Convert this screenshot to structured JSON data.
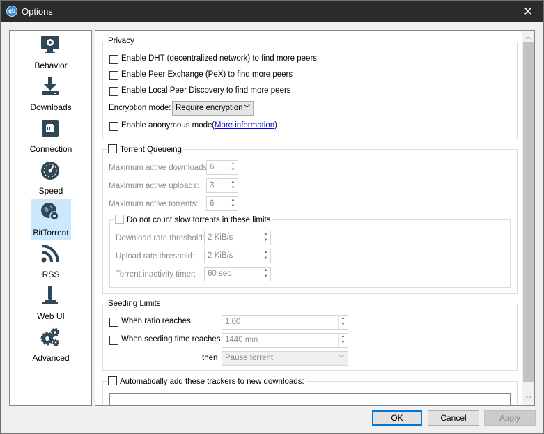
{
  "window": {
    "title": "Options",
    "app_icon_text": "qb"
  },
  "sidebar": {
    "items": [
      {
        "label": "Behavior",
        "icon": "monitor-gear-icon"
      },
      {
        "label": "Downloads",
        "icon": "download-icon"
      },
      {
        "label": "Connection",
        "icon": "network-port-icon"
      },
      {
        "label": "Speed",
        "icon": "speedometer-icon"
      },
      {
        "label": "BitTorrent",
        "icon": "globe-gear-icon",
        "selected": true
      },
      {
        "label": "RSS",
        "icon": "rss-icon"
      },
      {
        "label": "Web UI",
        "icon": "web-ui-icon"
      },
      {
        "label": "Advanced",
        "icon": "gears-icon"
      }
    ]
  },
  "privacy": {
    "title": "Privacy",
    "dht": "Enable DHT (decentralized network) to find more peers",
    "pex": "Enable Peer Exchange (PeX) to find more peers",
    "lpd": "Enable Local Peer Discovery to find more peers",
    "encryption_label": "Encryption mode:",
    "encryption_value": "Require encryption",
    "anonymous": "Enable anonymous mode",
    "paren_open": "(",
    "more_info": "More information",
    "paren_close": ")"
  },
  "queueing": {
    "title": "Torrent Queueing",
    "max_downloads_label": "Maximum active downloads:",
    "max_downloads": "6",
    "max_uploads_label": "Maximum active uploads:",
    "max_uploads": "3",
    "max_torrents_label": "Maximum active torrents:",
    "max_torrents": "6",
    "slow_title": "Do not count slow torrents in these limits",
    "dl_threshold_label": "Download rate threshold:",
    "dl_threshold": "2 KiB/s",
    "ul_threshold_label": "Upload rate threshold:",
    "ul_threshold": "2 KiB/s",
    "inactivity_label": "Torrent inactivity timer:",
    "inactivity": "60 sec"
  },
  "seeding": {
    "title": "Seeding Limits",
    "ratio_label": "When ratio reaches",
    "ratio": "1.00",
    "time_label": "When seeding time reaches",
    "time": "1440 min",
    "then_label": "then",
    "then_action": "Pause torrent"
  },
  "trackers": {
    "label": "Automatically add these trackers to new downloads:"
  },
  "buttons": {
    "ok": "OK",
    "cancel": "Cancel",
    "apply": "Apply"
  }
}
